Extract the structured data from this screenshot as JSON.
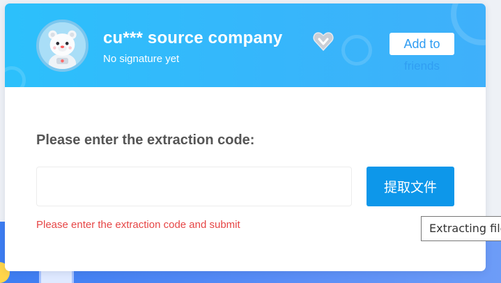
{
  "header": {
    "company_name": "cu*** source company",
    "signature": "No signature yet",
    "add_friend_line1": "Add to",
    "add_friend_line2": "friends",
    "badge_icon": "vip-heart-icon",
    "avatar_icon": "bear-astronaut-avatar"
  },
  "form": {
    "prompt": "Please enter the extraction code:",
    "input_value": "",
    "input_placeholder": "",
    "submit_label": "提取文件",
    "error_message": "Please enter the extraction code and submit"
  },
  "tooltip": {
    "text": "Extracting file"
  },
  "colors": {
    "header_gradient_start": "#2cc0fb",
    "header_gradient_end": "#3fb0fa",
    "button_blue": "#0d97ea",
    "error_red": "#e64545",
    "label_gray": "#555555"
  }
}
